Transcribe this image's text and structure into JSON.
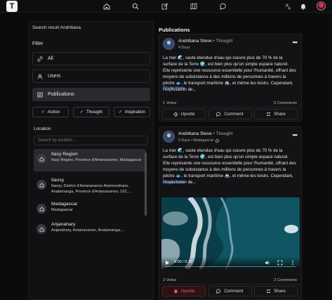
{
  "topbar": {
    "logo": "T",
    "nav_icons": [
      "home-icon",
      "search-icon",
      "edit-icon",
      "map-icon",
      "chat-icon"
    ],
    "right_icons": [
      "translate-icon",
      "bell-icon",
      "avatar"
    ]
  },
  "left": {
    "search_result": "Search result Andritiana",
    "filter_label": "Filter",
    "filters": [
      {
        "label": "All",
        "icon": "link-icon"
      },
      {
        "label": "Users",
        "icon": "user-icon"
      },
      {
        "label": "Publications",
        "icon": "newspaper-icon",
        "active": true
      }
    ],
    "chips": [
      {
        "label": "Action",
        "selected": true
      },
      {
        "label": "Thought",
        "selected": true
      },
      {
        "label": "Inspiration",
        "selected": true
      }
    ],
    "location_label": "Location",
    "location_placeholder": "Search by location ...",
    "locations": [
      {
        "title": "Itasy Region",
        "sub": "Itasy Region, Province d'Antananarivo, Madagascar",
        "active": true
      },
      {
        "title": "Itaosy",
        "sub": "Itaosy, District d'Antananarivo Atsimondrano, Analamanga, Province d'Antananarivo, 102,..."
      },
      {
        "title": "Madagascar",
        "sub": "Madagascar"
      },
      {
        "title": "Anjanahary",
        "sub": "Anjanahary, Antananarivo, Analamanga,..."
      }
    ]
  },
  "right": {
    "title": "Publications",
    "posts": [
      {
        "author": "Andritiana Steve",
        "type": "• Thought",
        "meta": "4 Days",
        "body": "La mer 🌊, vaste étendue d'eau qui couvre plus de 70 % de la surface de la Terre 🌍, est bien plus qu'un simple espace naturel. Elle représente une ressource essentielle pour l'humanité, offrant des moyens de subsistance à des millions de personnes à travers la pêche 🐟, le transport maritime 🚢, et même les loisirs. Cependant, l'exploitation de...",
        "show_more": "Show more",
        "votes": "1 Votes",
        "comments": "0 Comments",
        "actions": {
          "upvote": "Upvote",
          "comment": "Comment",
          "share": "Share"
        },
        "upvoted": false
      },
      {
        "author": "Andritiana Steve",
        "type": "• Thought",
        "meta": "5 Days • Madagascar",
        "body": "La mer 🌊, vaste étendue d'eau qui couvre plus de 70 % de la surface de la Terre 🌍, est bien plus qu'un simple espace naturel. Elle représente une ressource essentielle pour l'humanité, offrant des moyens de subsistance à des millions de personnes à travers la pêche 🐟, le transport maritime 🚢, et même les loisirs. Cependant, l'exploitation de...",
        "show_more": "Show more",
        "video_time": "0:00 / 0:33",
        "votes": "2 Votes",
        "comments": "2 Comments",
        "actions": {
          "upvote": "Upvote",
          "comment": "Comment",
          "share": "Share"
        },
        "upvoted": true
      }
    ]
  },
  "colors": {
    "accent_link": "#6ba3ff",
    "upvote_active": "#ff5b5b",
    "background": "#0b0b0c"
  }
}
